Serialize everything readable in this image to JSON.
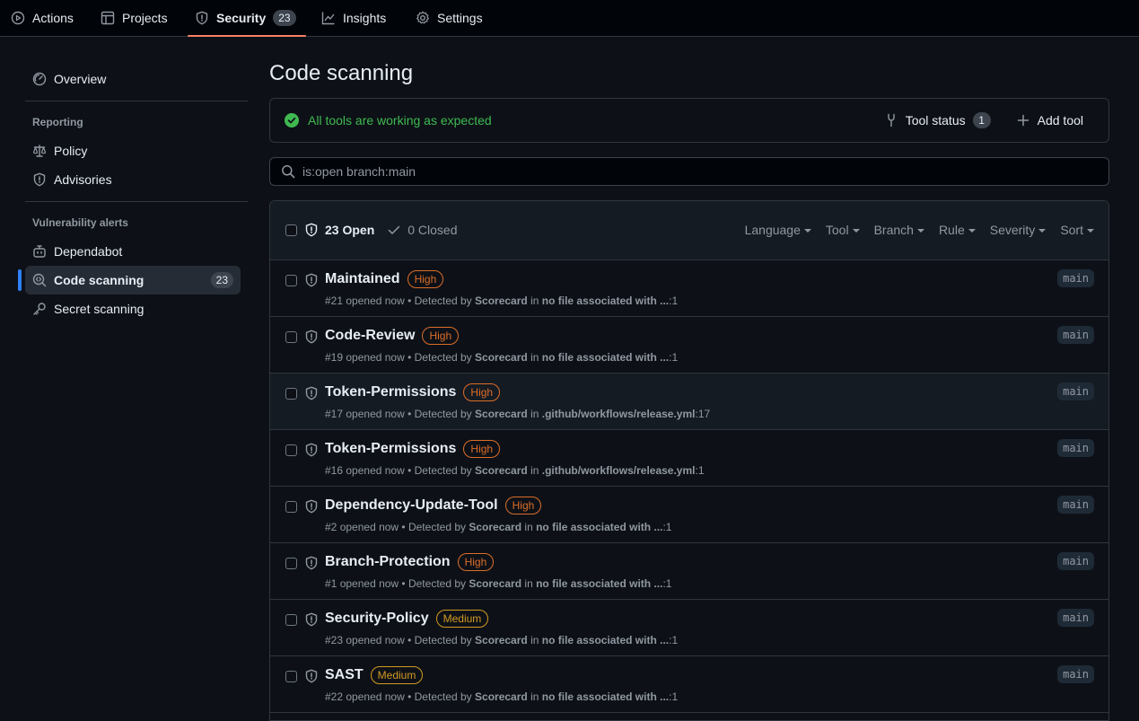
{
  "nav": {
    "tabs": [
      {
        "label": "Actions",
        "icon": "play-icon"
      },
      {
        "label": "Projects",
        "icon": "table-icon"
      },
      {
        "label": "Security",
        "icon": "shield-icon",
        "count": "23",
        "selected": true
      },
      {
        "label": "Insights",
        "icon": "graph-icon"
      },
      {
        "label": "Settings",
        "icon": "gear-icon"
      }
    ]
  },
  "sidebar": {
    "overview": "Overview",
    "reporting_heading": "Reporting",
    "policy": "Policy",
    "advisories": "Advisories",
    "vuln_heading": "Vulnerability alerts",
    "dependabot": "Dependabot",
    "code_scanning": "Code scanning",
    "code_scanning_count": "23",
    "secret_scanning": "Secret scanning"
  },
  "main": {
    "title": "Code scanning",
    "status_text": "All tools are working as expected",
    "tool_status_label": "Tool status",
    "tool_status_count": "1",
    "add_tool_label": "Add tool",
    "search_value": "is:open branch:main",
    "open_label": "23 Open",
    "closed_label": "0 Closed",
    "filters": [
      "Language",
      "Tool",
      "Branch",
      "Rule",
      "Severity",
      "Sort"
    ]
  },
  "alerts": [
    {
      "title": "Maintained",
      "severity": "High",
      "id": "#21",
      "opened": "opened now",
      "detected_prefix": "Detected by",
      "tool": "Scorecard",
      "in": "in",
      "location": "no file associated with ...",
      "line": ":1",
      "branch": "main"
    },
    {
      "title": "Code-Review",
      "severity": "High",
      "id": "#19",
      "opened": "opened now",
      "detected_prefix": "Detected by",
      "tool": "Scorecard",
      "in": "in",
      "location": "no file associated with ...",
      "line": ":1",
      "branch": "main"
    },
    {
      "title": "Token-Permissions",
      "severity": "High",
      "id": "#17",
      "opened": "opened now",
      "detected_prefix": "Detected by",
      "tool": "Scorecard",
      "in": "in",
      "location": ".github/workflows/release.yml",
      "line": ":17",
      "branch": "main"
    },
    {
      "title": "Token-Permissions",
      "severity": "High",
      "id": "#16",
      "opened": "opened now",
      "detected_prefix": "Detected by",
      "tool": "Scorecard",
      "in": "in",
      "location": ".github/workflows/release.yml",
      "line": ":1",
      "branch": "main"
    },
    {
      "title": "Dependency-Update-Tool",
      "severity": "High",
      "id": "#2",
      "opened": "opened now",
      "detected_prefix": "Detected by",
      "tool": "Scorecard",
      "in": "in",
      "location": "no file associated with ...",
      "line": ":1",
      "branch": "main"
    },
    {
      "title": "Branch-Protection",
      "severity": "High",
      "id": "#1",
      "opened": "opened now",
      "detected_prefix": "Detected by",
      "tool": "Scorecard",
      "in": "in",
      "location": "no file associated with ...",
      "line": ":1",
      "branch": "main"
    },
    {
      "title": "Security-Policy",
      "severity": "Medium",
      "id": "#23",
      "opened": "opened now",
      "detected_prefix": "Detected by",
      "tool": "Scorecard",
      "in": "in",
      "location": "no file associated with ...",
      "line": ":1",
      "branch": "main"
    },
    {
      "title": "SAST",
      "severity": "Medium",
      "id": "#22",
      "opened": "opened now",
      "detected_prefix": "Detected by",
      "tool": "Scorecard",
      "in": "in",
      "location": "no file associated with ...",
      "line": ":1",
      "branch": "main"
    }
  ],
  "colors": {
    "accent": "#2f81f7",
    "tab_underline": "#f78166",
    "success": "#3fb950",
    "high": "#db6d28",
    "medium": "#d29922"
  }
}
